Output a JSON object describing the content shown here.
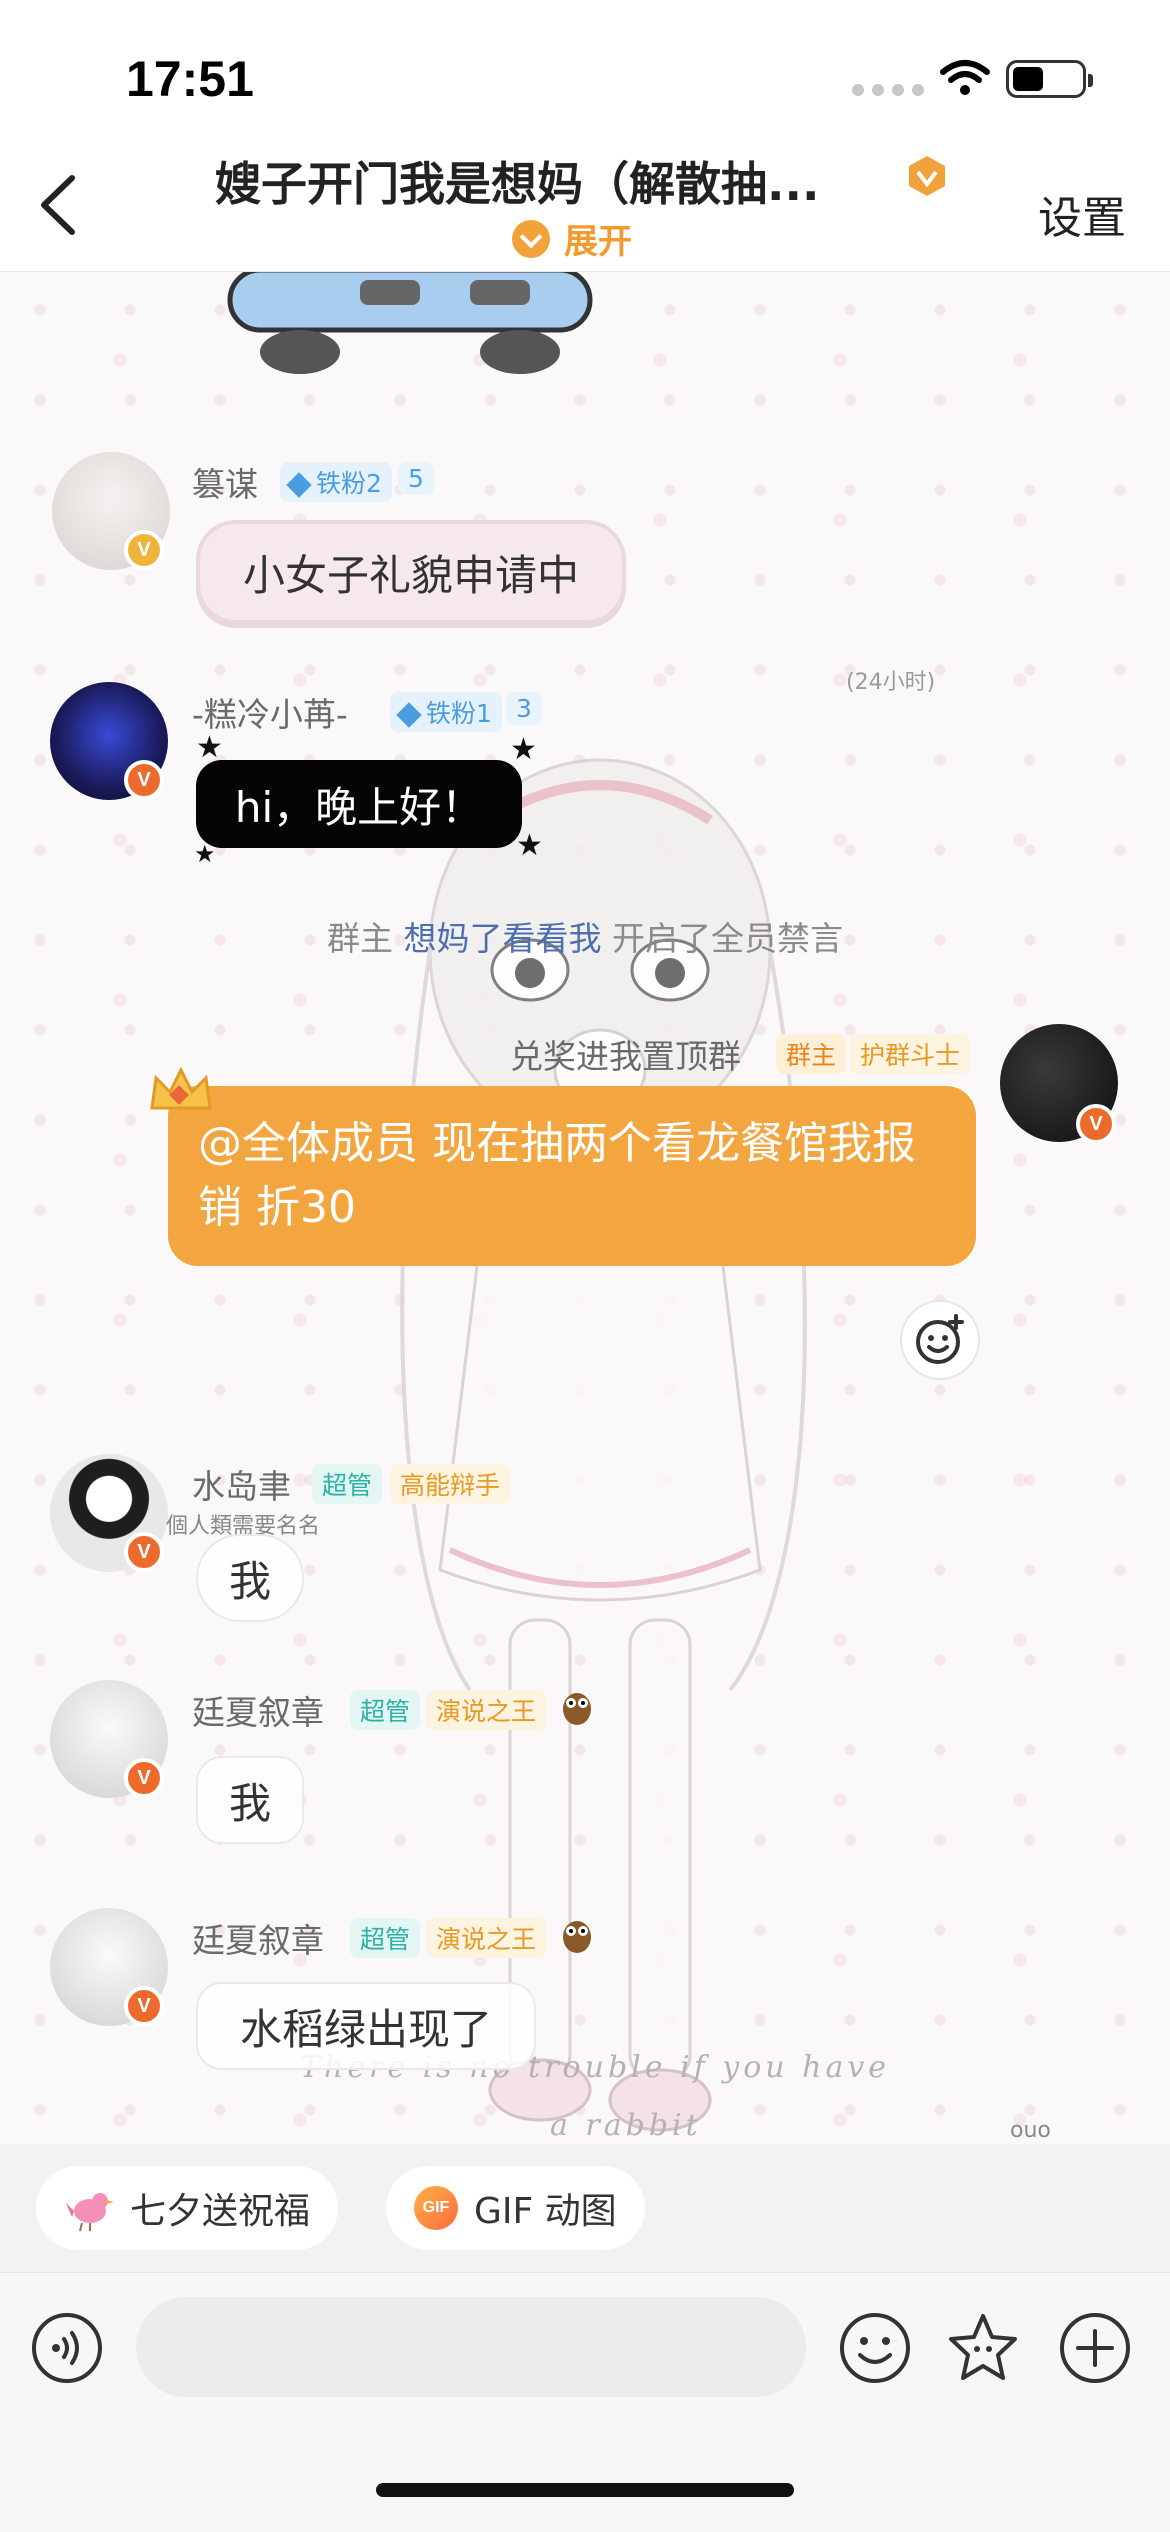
{
  "status_bar": {
    "time": "17:51",
    "battery_level": 0.45
  },
  "header": {
    "back_icon": "chevron-left-icon",
    "title": "嫂子开门我是想妈（解散抽...",
    "expand_label": "展开",
    "settings_label": "设置"
  },
  "messages": [
    {
      "nickname": "篡谋",
      "fan_tag": "铁粉2",
      "level": "5",
      "text": "小女子礼貌申请中"
    },
    {
      "nickname": "-糕冷小苒-",
      "fan_tag": "铁粉1",
      "level": "3",
      "text": "hi，晚上好！"
    },
    {
      "text": "@全体成员 现在抽两个看龙餐馆我报销 折30",
      "nickname": "兑奖进我置顶群",
      "role_tag": "群主",
      "title_tag": "护群斗士"
    },
    {
      "nickname": "水岛聿",
      "role_tag": "超管",
      "title_tag": "高能辩手",
      "text": "我",
      "note": "個人類需要名名"
    },
    {
      "nickname": "廷夏叙章",
      "role_tag": "超管",
      "title_tag": "演说之王",
      "text": "我"
    },
    {
      "nickname": "廷夏叙章",
      "role_tag": "超管",
      "title_tag": "演说之王",
      "text": "水稻绿出现了"
    }
  ],
  "system_message": {
    "prefix": "群主",
    "actor": "想妈了看看我",
    "suffix": "开启了全员禁言"
  },
  "time_note": "(24小时)",
  "wallpaper_text": {
    "line1": "There is no trouble if you have",
    "line2": "a rabbit",
    "corner": "ouo"
  },
  "quick_bar": {
    "chip1": "七夕送祝福",
    "chip2": "GIF 动图",
    "gif_icon_label": "GIF"
  },
  "input_bar": {
    "placeholder": ""
  },
  "colors": {
    "accent": "#f3a640",
    "owner_tag": "#e8851e",
    "admin_tag": "#2bb3a4"
  }
}
